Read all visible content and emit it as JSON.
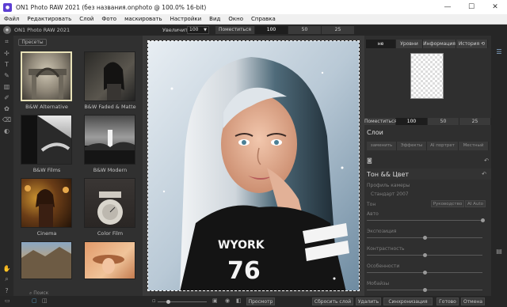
{
  "window": {
    "title": "ON1 Photo RAW 2021 (без названия.onphoto @ 100.0% 16-bit)",
    "minimize": "—",
    "maximize": "☐",
    "close": "✕"
  },
  "menu": [
    "Файл",
    "Редактировать",
    "Слой",
    "Фото",
    "маскировать",
    "Настройки",
    "Вид",
    "Окно",
    "Справка"
  ],
  "header": {
    "brand": "ON1 Photo RAW 2021",
    "zoom_label": "Увеличить",
    "zoom_value": "100",
    "fit_options": [
      "Поместиться",
      "100",
      "50",
      "25"
    ],
    "fit_active": "100"
  },
  "left_panel": {
    "presets_tab": "Пресеты",
    "thumbnails": [
      {
        "label": "B&W Alternative"
      },
      {
        "label": "B&W Faded & Matte"
      },
      {
        "label": "B&W Films"
      },
      {
        "label": "B&W Modern"
      },
      {
        "label": "Cinema"
      },
      {
        "label": "Color Film"
      }
    ],
    "search_placeholder": "Поиск"
  },
  "right_panel": {
    "tabs": [
      "не",
      "Уровни",
      "Информация",
      "История ⟲"
    ],
    "active_tab": "не",
    "nav_fit": [
      "Поместиться",
      "100",
      "50",
      "25"
    ],
    "layers_title": "Слои",
    "layer_buttons": [
      "заменить",
      "Эффекты",
      "AI портрет",
      "Местный"
    ],
    "tone_title": "Тон && Цвет",
    "profile_label": "Профиль камеры",
    "profile_value": "Стандарт 2007",
    "tone_label": "Тон",
    "tone_buttons": [
      "Руководство",
      "AI Auto"
    ],
    "sliders": [
      {
        "label": "Авто",
        "value": 1.0
      },
      {
        "label": "Экспозиция",
        "value": 0.5
      },
      {
        "label": "Контрастность",
        "value": 0.5
      },
      {
        "label": "Особенности",
        "value": 0.5
      },
      {
        "label": "Мобайзы",
        "value": 0.5
      }
    ]
  },
  "bottom_bar": {
    "preview": "Просмотр",
    "reset_layer": "Сбросить слой",
    "delete": "Удалить",
    "sync": "Синхронизация",
    "done": "Готово",
    "cancel": "Отмена"
  }
}
